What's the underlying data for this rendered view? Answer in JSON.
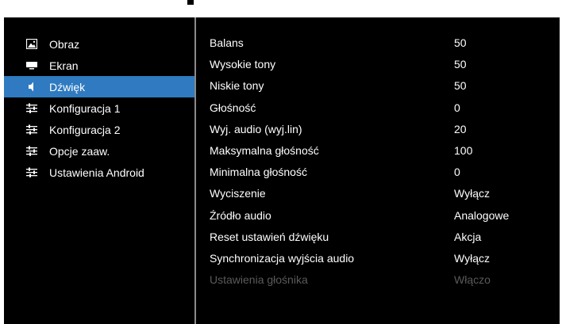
{
  "sidebar": {
    "items": [
      {
        "label": "Obraz",
        "icon": "picture-icon",
        "active": false
      },
      {
        "label": "Ekran",
        "icon": "monitor-icon",
        "active": false
      },
      {
        "label": "Dźwięk",
        "icon": "speaker-icon",
        "active": true
      },
      {
        "label": "Konfiguracja 1",
        "icon": "sliders-icon",
        "active": false
      },
      {
        "label": "Konfiguracja 2",
        "icon": "sliders-icon",
        "active": false
      },
      {
        "label": "Opcje zaaw.",
        "icon": "sliders-icon",
        "active": false
      },
      {
        "label": "Ustawienia Android",
        "icon": "sliders-icon",
        "active": false
      }
    ]
  },
  "settings": {
    "rows": [
      {
        "label": "Balans",
        "value": "50",
        "disabled": false
      },
      {
        "label": "Wysokie tony",
        "value": "50",
        "disabled": false
      },
      {
        "label": "Niskie tony",
        "value": "50",
        "disabled": false
      },
      {
        "label": "Głośność",
        "value": "0",
        "disabled": false
      },
      {
        "label": "Wyj. audio (wyj.lin)",
        "value": "20",
        "disabled": false
      },
      {
        "label": "Maksymalna głośność",
        "value": "100",
        "disabled": false
      },
      {
        "label": "Minimalna głośność",
        "value": "0",
        "disabled": false
      },
      {
        "label": "Wyciszenie",
        "value": "Wyłącz",
        "disabled": false
      },
      {
        "label": "Źródło audio",
        "value": "Analogowe",
        "disabled": false
      },
      {
        "label": "Reset ustawień dźwięku",
        "value": "Akcja",
        "disabled": false
      },
      {
        "label": "Synchronizacja wyjścia audio",
        "value": "Wyłącz",
        "disabled": false
      },
      {
        "label": "Ustawienia głośnika",
        "value": "Włączo",
        "disabled": true
      }
    ]
  },
  "colors": {
    "background": "#000000",
    "selected": "#2f7ac0",
    "text": "#ffffff",
    "disabled_text": "#5a5a5a",
    "divider": "#8a8a8a"
  }
}
